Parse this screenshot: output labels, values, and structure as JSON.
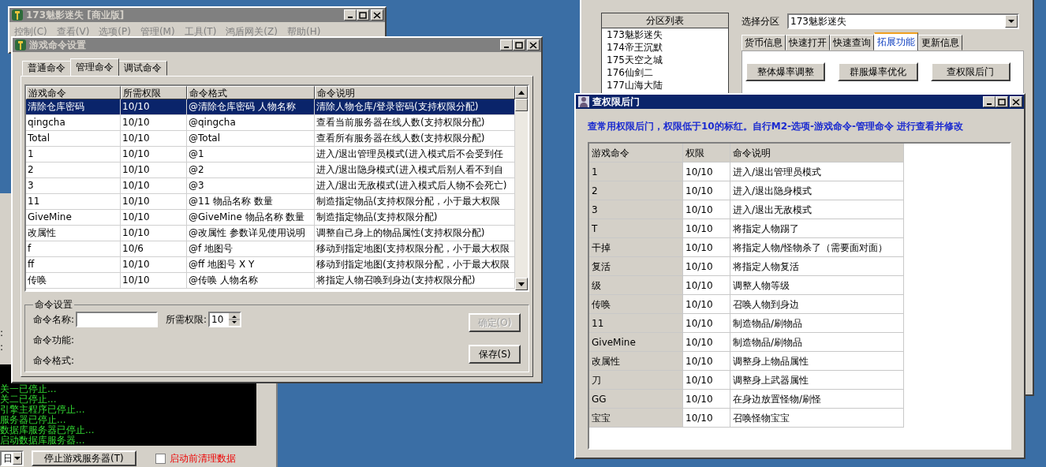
{
  "main_window": {
    "title": "173魅影迷失 [商业版]",
    "menu": [
      "控制(C)",
      "查看(V)",
      "选项(P)",
      "管理(M)",
      "工具(T)",
      "鸿盾网关(Z)",
      "帮助(H)"
    ],
    "status_labels": [
      ":",
      ":"
    ],
    "log_lines": [
      "关一已停止...",
      "关二已停止...",
      "引擎主程序已停止...",
      "服务器已停止...",
      "数据库服务器已停止...",
      "启动数据库服务器..."
    ],
    "period_select": {
      "value": "日"
    },
    "stop_button": "停止游戏服务器(T)",
    "clean_checkbox": {
      "label": "启动前清理数据",
      "checked": false
    }
  },
  "command_dialog": {
    "title": "游戏命令设置",
    "tabs": [
      {
        "label": "普通命令",
        "selected": false
      },
      {
        "label": "管理命令",
        "selected": true
      },
      {
        "label": "调试命令",
        "selected": false
      }
    ],
    "table": {
      "columns": [
        "游戏命令",
        "所需权限",
        "命令格式",
        "命令说明"
      ],
      "rows": [
        {
          "cells": [
            "清除仓库密码",
            "10/10",
            "@清除仓库密码 人物名称",
            "清除人物仓库/登录密码(支持权限分配)"
          ],
          "selected": true
        },
        {
          "cells": [
            "qingcha",
            "10/10",
            "@qingcha",
            "查看当前服务器在线人数(支持权限分配)"
          ],
          "selected": false
        },
        {
          "cells": [
            "Total",
            "10/10",
            "@Total",
            "查看所有服务器在线人数(支持权限分配)"
          ],
          "selected": false
        },
        {
          "cells": [
            "1",
            "10/10",
            "@1",
            "进入/退出管理员模式(进入模式后不会受到任"
          ],
          "selected": false
        },
        {
          "cells": [
            "2",
            "10/10",
            "@2",
            "进入/退出隐身模式(进入模式后别人看不到自"
          ],
          "selected": false
        },
        {
          "cells": [
            "3",
            "10/10",
            "@3",
            "进入/退出无敌模式(进入模式后人物不会死亡)"
          ],
          "selected": false
        },
        {
          "cells": [
            "11",
            "10/10",
            "@11 物品名称 数量",
            "制造指定物品(支持权限分配，小于最大权限"
          ],
          "selected": false
        },
        {
          "cells": [
            "GiveMine",
            "10/10",
            "@GiveMine 物品名称 数量",
            "制造指定物品(支持权限分配)"
          ],
          "selected": false
        },
        {
          "cells": [
            "改属性",
            "10/10",
            "@改属性 参数详见使用说明",
            "调整自己身上的物品属性(支持权限分配)"
          ],
          "selected": false
        },
        {
          "cells": [
            "f",
            "10/6",
            "@f 地图号",
            "移动到指定地图(支持权限分配，小于最大权限"
          ],
          "selected": false
        },
        {
          "cells": [
            "ff",
            "10/10",
            "@ff 地图号 X Y",
            "移动到指定地图(支持权限分配，小于最大权限"
          ],
          "selected": false
        },
        {
          "cells": [
            "传唤",
            "10/10",
            "@传唤 人物名称",
            "将指定人物召唤到身边(支持权限分配)"
          ],
          "selected": false
        }
      ]
    },
    "settings": {
      "title": "命令设置",
      "name_label": "命令名称:",
      "permission_label": "所需权限:",
      "permission_value": "10",
      "function_label": "命令功能:",
      "format_label": "命令格式:",
      "buttons": [
        {
          "label": "确定(O)",
          "disabled": true
        },
        {
          "label": "保存(S)",
          "disabled": false
        }
      ]
    }
  },
  "server_window": {
    "list_header": "分区列表",
    "list_items": [
      "173魅影迷失",
      "174帝王沉默",
      "175天空之城",
      "176仙剑二",
      "177山海大陆"
    ],
    "select_label": "选择分区",
    "select_value": "173魅影迷失",
    "tabs": [
      {
        "label": "货币信息",
        "selected": false
      },
      {
        "label": "快速打开",
        "selected": false
      },
      {
        "label": "快速查询",
        "selected": false
      },
      {
        "label": "拓展功能",
        "selected": true
      },
      {
        "label": "更新信息",
        "selected": false
      }
    ],
    "buttons": [
      "整体爆率调整",
      "群服爆率优化",
      "查权限后门"
    ]
  },
  "permission_window": {
    "title": "查权限后门",
    "note": "查常用权限后门，权限低于10的标红。自行M2-选项-游戏命令-管理命令 进行查看并修改",
    "table": {
      "columns": [
        "游戏命令",
        "权限",
        "命令说明"
      ],
      "rows": [
        [
          "1",
          "10/10",
          "进入/退出管理员模式"
        ],
        [
          "2",
          "10/10",
          "进入/退出隐身模式"
        ],
        [
          "3",
          "10/10",
          "进入/退出无敌模式"
        ],
        [
          "T",
          "10/10",
          "将指定人物踢了"
        ],
        [
          "干掉",
          "10/10",
          "将指定人物/怪物杀了（需要面对面）"
        ],
        [
          "复活",
          "10/10",
          "将指定人物复活"
        ],
        [
          "级",
          "10/10",
          "调整人物等级"
        ],
        [
          "传唤",
          "10/10",
          "召唤人物到身边"
        ],
        [
          "11",
          "10/10",
          "制造物品/刷物品"
        ],
        [
          "GiveMine",
          "10/10",
          "制造物品/刷物品"
        ],
        [
          "改属性",
          "10/10",
          "调整身上物品属性"
        ],
        [
          "刀",
          "10/10",
          "调整身上武器属性"
        ],
        [
          "GG",
          "10/10",
          "在身边放置怪物/刷怪"
        ],
        [
          "宝宝",
          "10/10",
          "召唤怪物宝宝"
        ]
      ]
    }
  }
}
